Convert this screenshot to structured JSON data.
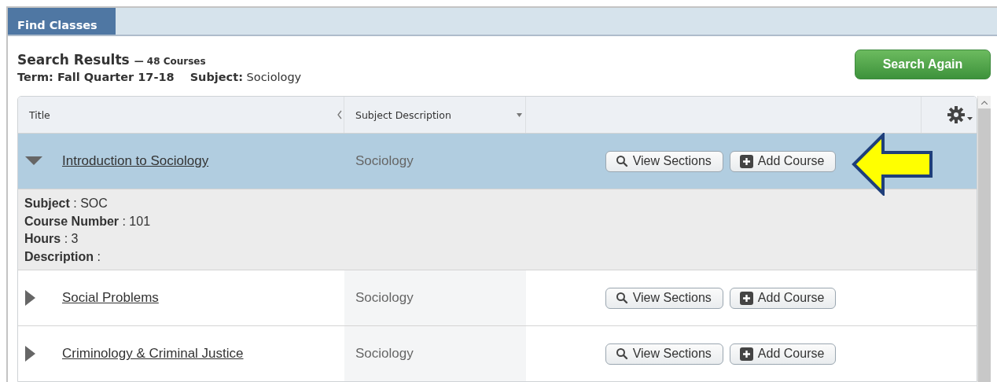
{
  "tabs": [
    {
      "label": "Find Classes",
      "selected": true
    }
  ],
  "results": {
    "title": "Search Results",
    "count": "— 48 Courses",
    "term": "Term: Fall Quarter 17-18",
    "subject_label": "Subject:",
    "subject_value": "Sociology",
    "search_again": "Search Again"
  },
  "table": {
    "columns": [
      "Title",
      "Subject Description"
    ],
    "rows": [
      {
        "title": "Introduction to Sociology",
        "subject": "Sociology",
        "expanded": true,
        "selected": true,
        "buttons": [
          "View Sections",
          "Add Course"
        ],
        "details": [
          "**Subject** : SOC",
          "**Course Number** : 101",
          "**Hours** : 3",
          "**Description** :"
        ]
      },
      {
        "title": "Social Problems",
        "subject": "Sociology",
        "expanded": false,
        "selected": false,
        "buttons": [
          "View Sections",
          "Add Course"
        ]
      },
      {
        "title": "Criminology & Criminal Justice",
        "subject": "Sociology",
        "expanded": false,
        "selected": false,
        "buttons": [
          "View Sections",
          "Add Course"
        ]
      }
    ]
  }
}
